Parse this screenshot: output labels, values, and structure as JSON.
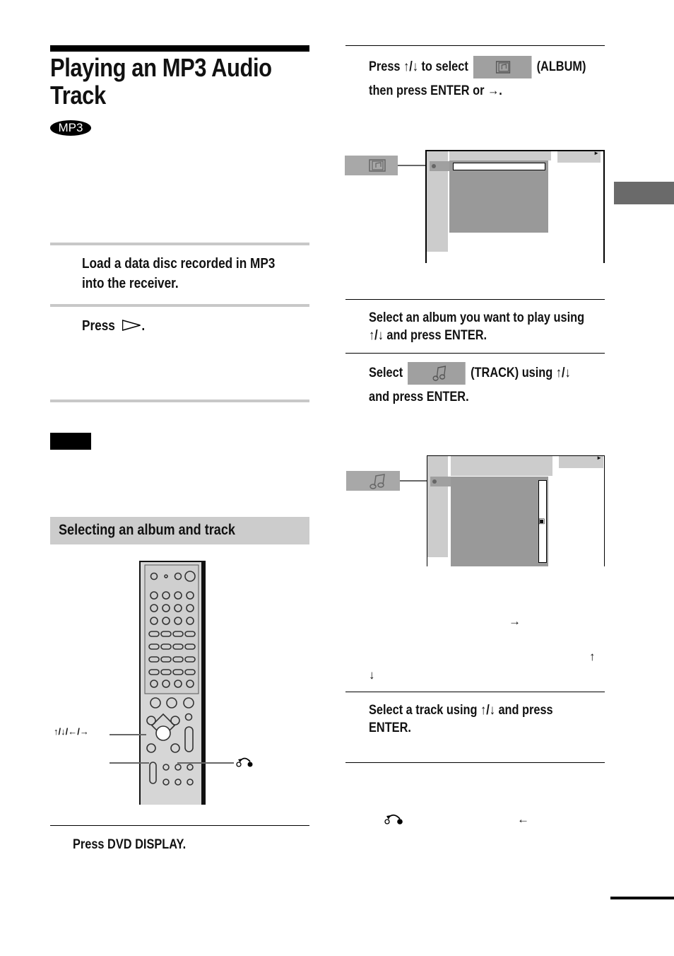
{
  "page": {
    "title": "Playing an MP3 Audio Track",
    "title_line1": "Playing an MP3 Audio",
    "title_line2": "Track",
    "badge": "MP3"
  },
  "left_column": {
    "steps": [
      {
        "text_line1": "Load a data disc recorded in MP3",
        "text_line2": "into the receiver."
      },
      {
        "text": "Press",
        "icon": "play-icon",
        "suffix": "."
      }
    ],
    "note_label": "",
    "section_heading": "Selecting an album and track",
    "remote_callouts": {
      "arrows_label": "↑/↓/←/→",
      "return_icon": "return-icon"
    },
    "step_display": "Press DVD DISPLAY."
  },
  "right_column": {
    "step_album": {
      "line1_pre": "Press ↑/↓ to select",
      "line1_post": "(ALBUM)",
      "line2": "then press ENTER or →."
    },
    "step_select_album": {
      "line1": "Select an album you want to play using",
      "line2": "↑/↓ and press ENTER."
    },
    "step_track": {
      "line1_pre": "Select",
      "line1_post": "(TRACK) using ↑/↓",
      "line2": "and press ENTER."
    },
    "notes_arrows": {
      "right": "→",
      "up": "↑",
      "down": "↓"
    },
    "step_select_track": {
      "line1": "Select a track using ↑/↓ and press",
      "line2": "ENTER."
    },
    "footer_icons": {
      "return_icon": "return-icon",
      "left_arrow": "←"
    }
  },
  "colors": {
    "tab_marker": "#6a6a6a",
    "section_bg": "#cccccc",
    "screen_dark": "#999999",
    "screen_light": "#cccccc"
  }
}
